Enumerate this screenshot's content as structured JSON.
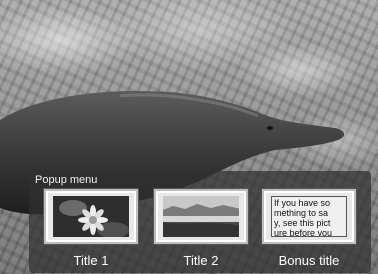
{
  "popup": {
    "title": "Popup menu",
    "items": [
      {
        "label": "Title  1",
        "thumbnail": "flower-thumbnail"
      },
      {
        "label": "Title  2",
        "thumbnail": "landscape-thumbnail"
      },
      {
        "label": "Bonus title",
        "thumbnail": "text-thumbnail",
        "thumbnail_text": "If you have so\nmething to sa\ny, see this pict\nure before you"
      }
    ]
  },
  "colors": {
    "panel": "#303030",
    "label": "#ffffff"
  }
}
